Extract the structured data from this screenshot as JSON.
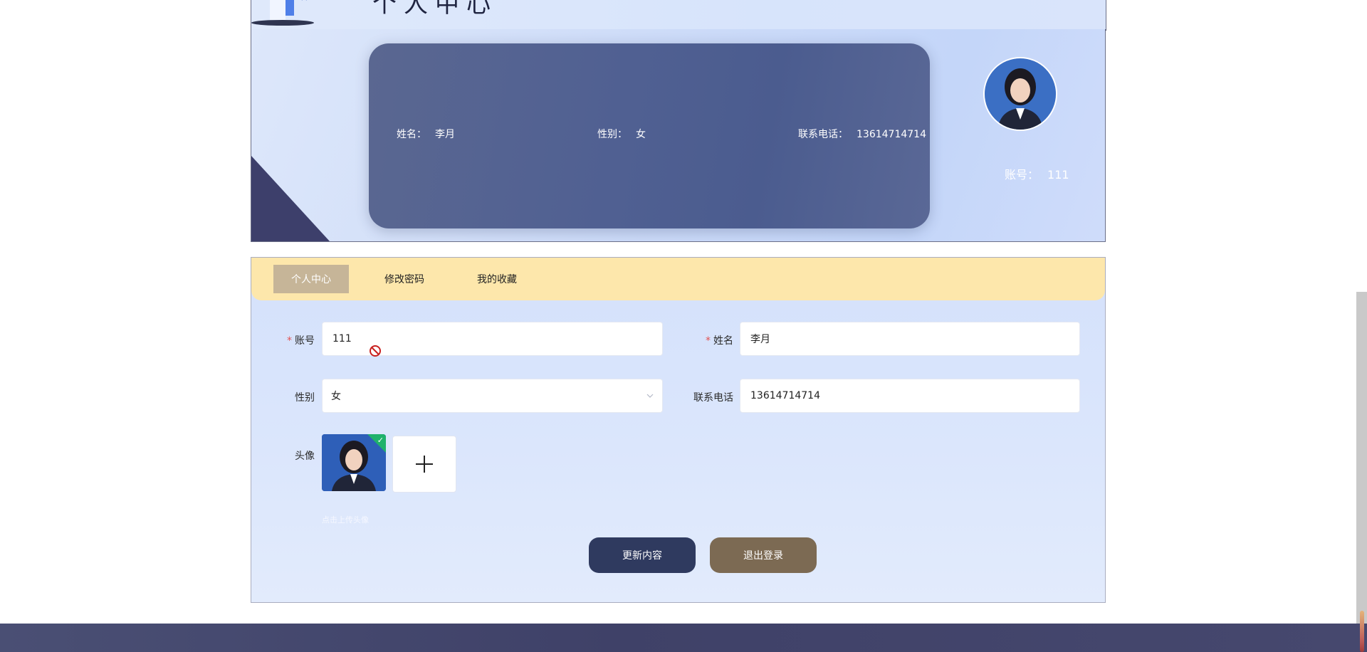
{
  "banner": {
    "title": "个人中心"
  },
  "profile": {
    "name_label": "姓名：",
    "name_value": "李月",
    "gender_label": "性别：",
    "gender_value": "女",
    "phone_label": "联系电话：",
    "phone_value": "13614714714",
    "account_label": "账号：",
    "account_value": "111"
  },
  "tabs": [
    {
      "label": "个人中心",
      "active": true
    },
    {
      "label": "修改密码",
      "active": false
    },
    {
      "label": "我的收藏",
      "active": false
    }
  ],
  "form": {
    "account_label": "账号",
    "account_value": "111",
    "name_label": "姓名",
    "name_value": "李月",
    "gender_label": "性别",
    "gender_value": "女",
    "phone_label": "联系电话",
    "phone_value": "13614714714",
    "avatar_label": "头像",
    "upload_hint": "点击上传头像",
    "update_button": "更新内容",
    "logout_button": "退出登录"
  },
  "colors": {
    "tab_bar": "#fde7ab",
    "tab_active": "#c6b598",
    "update_button": "#2f3a5f",
    "logout_button": "#7c6a53",
    "info_card": "#506092",
    "required_star": "#e25252",
    "upload_success": "#1fb26b"
  },
  "icons": {
    "upload": "plus-icon",
    "disabled_cursor": "not-allowed-icon",
    "select_arrow": "chevron-down-icon",
    "upload_status": "check-icon"
  }
}
